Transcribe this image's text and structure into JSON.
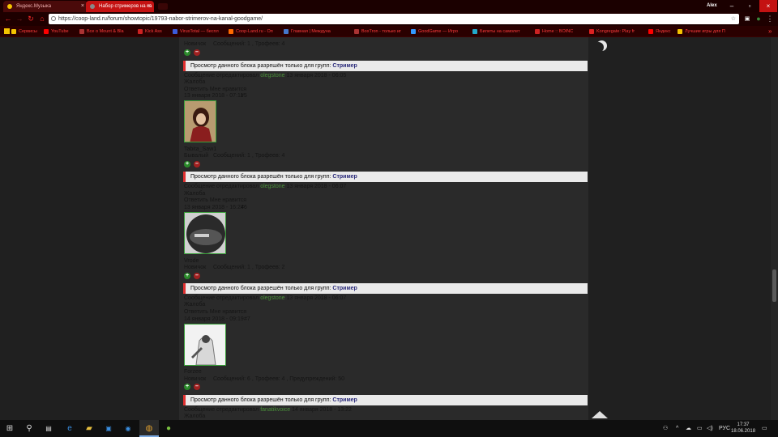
{
  "browser": {
    "tabs": [
      {
        "label": "Яндекс.Музыка",
        "favicon_color": "#f5c400"
      },
      {
        "label": "Набор стримеров на ка",
        "favicon_color": "#888888"
      }
    ],
    "user": "Alex",
    "url": "https://coop-land.ru/forum/showtopic/19793-nabor-strimerov-na-kanal-goodgame/",
    "bookmarks": [
      {
        "label": "Сервисы",
        "color": "#f5c400"
      },
      {
        "label": "YouTube",
        "color": "#ff0000"
      },
      {
        "label": "Все о Mount & Bla",
        "color": "#aa3333"
      },
      {
        "label": "Kick Ass",
        "color": "#cc2222"
      },
      {
        "label": "VirusTotal — беспл",
        "color": "#3b5bdb"
      },
      {
        "label": "Coop-Land.ru - Оп",
        "color": "#ff6a00"
      },
      {
        "label": "Главная | Междуна",
        "color": "#4477cc"
      },
      {
        "label": "BoxTron - только иг",
        "color": "#aa3333"
      },
      {
        "label": "GoodGame — Игро",
        "color": "#3399ff"
      },
      {
        "label": "Билеты на самолет",
        "color": "#22aacc"
      },
      {
        "label": "Home :: BOINC",
        "color": "#cc2222"
      },
      {
        "label": "Kongregate: Play fr",
        "color": "#dd2222"
      },
      {
        "label": "Яндекс",
        "color": "#ff0000"
      },
      {
        "label": "Лучшие игры для П",
        "color": "#f5c400"
      }
    ]
  },
  "posts": [
    {
      "status": "Новичок",
      "stats": "Сообщений: 1 , Трофеев: 4",
      "banner_text": "Просмотр данного блока разрешён только для групп:",
      "banner_group": "Стример",
      "edited_prefix": "Сообщение отредактировал",
      "edited_user": "olegstone",
      "edited_date": "13 января 2018 - 06:05",
      "complaint": "Жалоба",
      "actions": "Ответить  Мне нравится",
      "next_date": "13 января 2018 - 07:11",
      "next_num": "#5"
    },
    {
      "username": "Tabita_Saw1",
      "status": "Бывалый",
      "stats": "Сообщений: 1 , Трофеев: 4",
      "banner_text": "Просмотр данного блока разрешён только для групп:",
      "banner_group": "Стример",
      "edited_prefix": "Сообщение отредактировал",
      "edited_user": "olegstone",
      "edited_date": "13 января 2018 - 06:07",
      "complaint": "Жалоба",
      "actions": "Ответить  Мне нравится",
      "next_date": "13 января 2018 - 16:24",
      "next_num": "#6"
    },
    {
      "username": "Vrode",
      "status": "Новичок",
      "stats": "Сообщений: 1 , Трофеев: 2",
      "banner_text": "Просмотр данного блока разрешён только для групп:",
      "banner_group": "Стример",
      "edited_prefix": "Сообщение отредактировал",
      "edited_user": "olegstone",
      "edited_date": "13 января 2018 - 06:07",
      "complaint": "Жалоба",
      "actions": "Ответить  Мне нравится",
      "next_date": "14 января 2018 - 09:19",
      "next_num": "#7"
    },
    {
      "username": "Forzee",
      "status": "Новичок",
      "stats": "Сообщений: 6 , Трофеев: 4 , Предупреждений: 50",
      "banner_text": "Просмотр данного блока разрешён только для групп:",
      "banner_group": "Стример",
      "edited_prefix": "Сообщение отредактировал",
      "edited_user": "fanatikvoice",
      "edited_date": "14 января 2018 - 13:22",
      "complaint": "Жалоба"
    }
  ],
  "taskbar": {
    "lang": "РУС",
    "time": "17:37",
    "date": "18.06.2018"
  }
}
